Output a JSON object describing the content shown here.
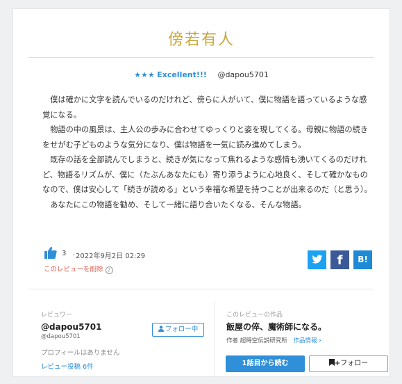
{
  "review": {
    "title": "傍若有人",
    "stars": "★★★",
    "rating_label": "Excellent!!!",
    "reviewer_handle": "@dapou5701",
    "paragraphs": [
      "僕は確かに文字を読んでいるのだけれど、傍らに人がいて、僕に物語を語っているような感覚になる。",
      "物語の中の風景は、主人公の歩みに合わせてゆっくりと姿を現してくる。母親に物語の続きをせがむ子どものような気分になり、僕は物語を一気に読み進めてしまう。",
      "既存の話を全部読んでしまうと、続きが気になって焦れるような感情も湧いてくるのだけれど、物語るリズムが、僕に（たぶんあなたにも）寄り添うように心地良く、そして確かなものなので、僕は安心して「続きが読める」という幸福な希望を持つことが出来るのだ（と思う）。",
      "あなたにこの物語を勧め、そして一緒に語り合いたくなる、そんな物語。"
    ],
    "like_count": "3",
    "separator": "・",
    "date": "2022年9月2日 02:29",
    "delete_label": "このレビューを削除",
    "help_glyph": "?"
  },
  "share": {
    "twitter_glyph": "🐦",
    "facebook_glyph": "f",
    "hatena_glyph": "B!",
    "twitter_color": "#1da1f2",
    "facebook_color": "#3b5998",
    "hatena_color": "#1e8ad6"
  },
  "reviewer": {
    "section_label": "レビュワー",
    "name": "@dapou5701",
    "handle": "@dapou5701",
    "follow_label": "フォロー中",
    "no_profile": "プロフィールはありません",
    "posts_label": "レビュー投稿 6件"
  },
  "work": {
    "section_label": "このレビューの作品",
    "title": "飯屋の倅、魔術師になる。",
    "author_prefix": "作者",
    "author": "超時空伝説研究所",
    "info_label": "作品情報",
    "read_button": "1話目から読む",
    "follow_button": "フォロー"
  },
  "colors": {
    "title_gold": "#c9a73a",
    "accent_blue": "#2f8fd8",
    "delete_red": "#e05a4a"
  }
}
